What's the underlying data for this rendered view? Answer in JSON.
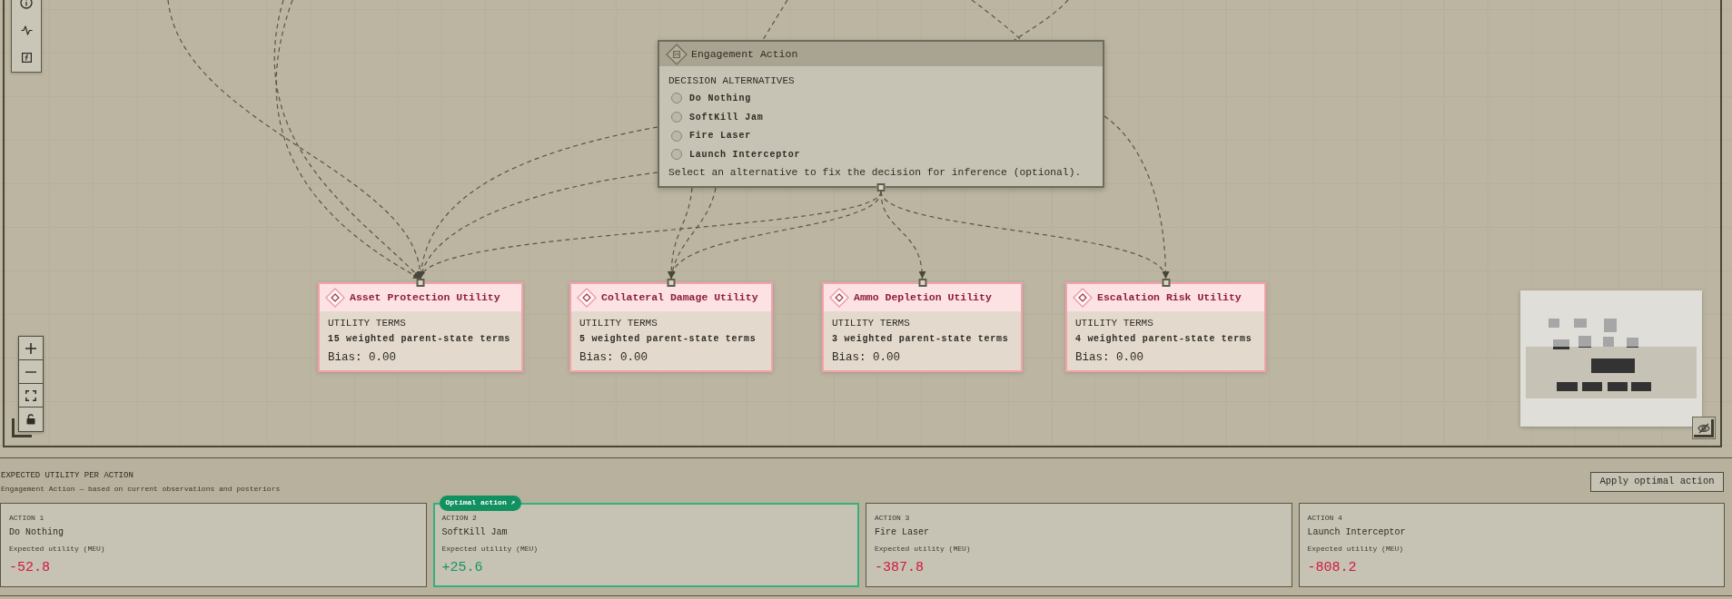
{
  "decision_node": {
    "title": "Engagement Action",
    "section_label": "DECISION ALTERNATIVES",
    "alternatives": [
      {
        "label": "Do Nothing",
        "selected": false
      },
      {
        "label": "SoftKill Jam",
        "selected": false
      },
      {
        "label": "Fire Laser",
        "selected": false
      },
      {
        "label": "Launch Interceptor",
        "selected": false
      }
    ],
    "hint": "Select an alternative to fix the decision for inference (optional)."
  },
  "utility_nodes": [
    {
      "title": "Asset Protection Utility",
      "section_label": "UTILITY TERMS",
      "terms": "15 weighted parent-state terms",
      "bias": "Bias: 0.00"
    },
    {
      "title": "Collateral Damage Utility",
      "section_label": "UTILITY TERMS",
      "terms": "5 weighted parent-state terms",
      "bias": "Bias: 0.00"
    },
    {
      "title": "Ammo Depletion Utility",
      "section_label": "UTILITY TERMS",
      "terms": "3 weighted parent-state terms",
      "bias": "Bias: 0.00"
    },
    {
      "title": "Escalation Risk Utility",
      "section_label": "UTILITY TERMS",
      "terms": "4 weighted parent-state terms",
      "bias": "Bias: 0.00"
    }
  ],
  "expected_utility_panel": {
    "title": "EXPECTED UTILITY PER ACTION",
    "subtitle": "Engagement Action — based on current observations and posteriors",
    "apply_button": "Apply optimal action",
    "optimal_badge": "Optimal action ↗",
    "actions": [
      {
        "label": "ACTION 1",
        "name": "Do Nothing",
        "metric_label": "Expected utility (MEU)",
        "value": "-52.8",
        "color": "#d2183c",
        "optimal": false
      },
      {
        "label": "ACTION 2",
        "name": "SoftKill Jam",
        "metric_label": "Expected utility (MEU)",
        "value": "+25.6",
        "color": "#13945f",
        "optimal": true
      },
      {
        "label": "ACTION 3",
        "name": "Fire Laser",
        "metric_label": "Expected utility (MEU)",
        "value": "-387.8",
        "color": "#d2183c",
        "optimal": false
      },
      {
        "label": "ACTION 4",
        "name": "Launch Interceptor",
        "metric_label": "Expected utility (MEU)",
        "value": "-808.2",
        "color": "#d2183c",
        "optimal": false
      }
    ]
  }
}
